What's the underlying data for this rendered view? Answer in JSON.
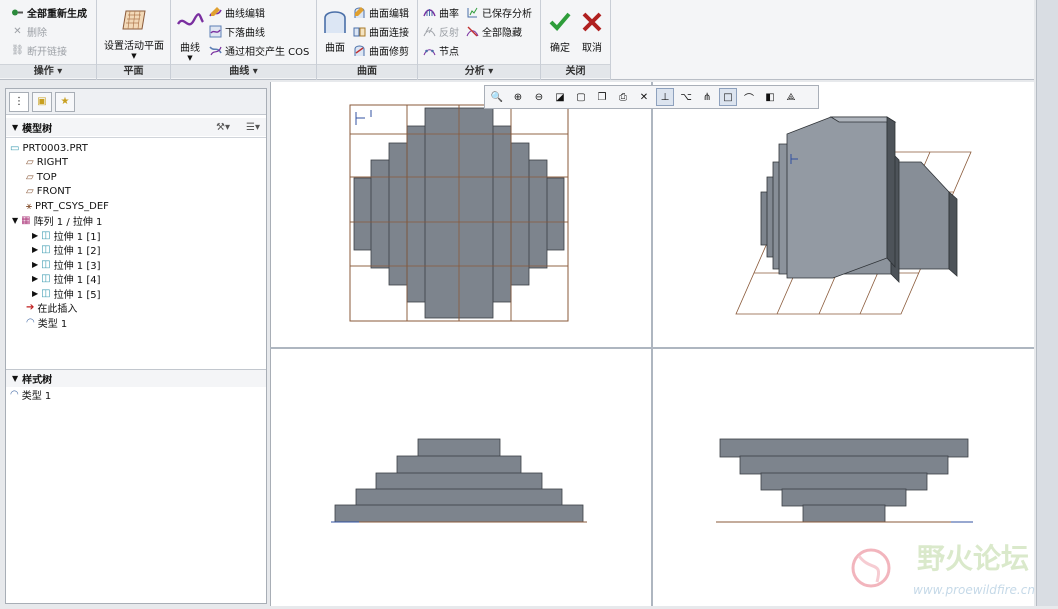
{
  "ribbon": {
    "operations": {
      "regen": "全部重新生成",
      "delete": "删除",
      "break": "断开链接",
      "label": "操作 ▾"
    },
    "plane": {
      "set_active": "设置活动平面",
      "label": "平面"
    },
    "curves": {
      "curve": "曲线",
      "edit": "曲线编辑",
      "drop": "下落曲线",
      "cos": "通过相交产生 COS",
      "label": "曲线 ▾"
    },
    "surface": {
      "surface": "曲面",
      "edit": "曲面编辑",
      "connect": "曲面连接",
      "trim": "曲面修剪",
      "label": "曲面"
    },
    "analysis": {
      "curvature": "曲率",
      "saved": "已保存分析",
      "reflect": "反射",
      "hide_all": "全部隐藏",
      "node": "节点",
      "label": "分析 ▾"
    },
    "close": {
      "ok": "确定",
      "cancel": "取消",
      "label": "关闭"
    }
  },
  "model_tree": {
    "header": "模型树",
    "root": "PRT0003.PRT",
    "items": [
      "RIGHT",
      "TOP",
      "FRONT",
      "PRT_CSYS_DEF"
    ],
    "pattern": "阵列 1 / 拉伸 1",
    "pattern_children": [
      "拉伸 1 [1]",
      "拉伸 1 [2]",
      "拉伸 1 [3]",
      "拉伸 1 [4]",
      "拉伸 1 [5]"
    ],
    "insert_here": "在此插入",
    "type": "类型 1"
  },
  "style_tree": {
    "header": "样式树",
    "item": "类型 1"
  },
  "watermark": {
    "text": "野火论坛",
    "url": "www.proewildfire.cn"
  },
  "colors": {
    "part": "#7d848d",
    "part_edge": "#3b3f45",
    "grid": "#8a5a3a",
    "accent": "#d32f2f",
    "ok": "#2e9d3a"
  }
}
